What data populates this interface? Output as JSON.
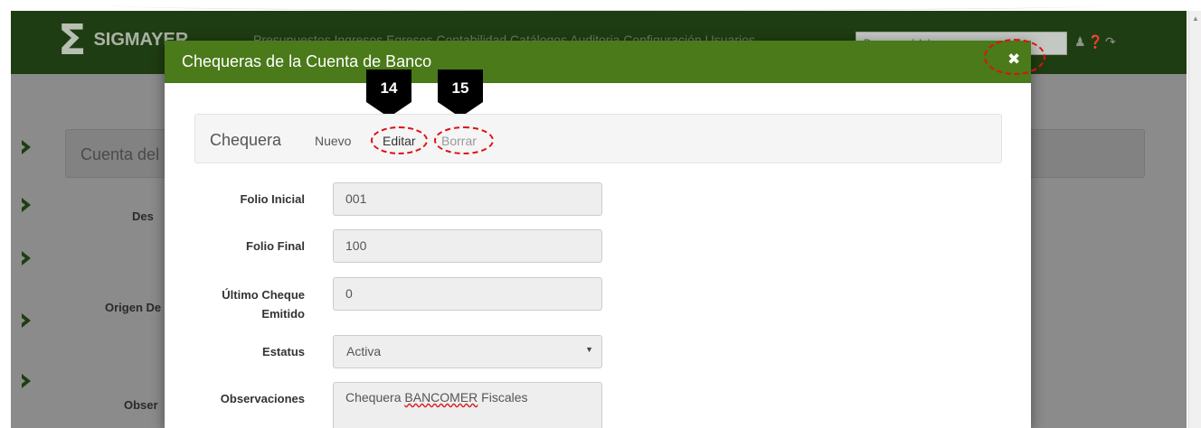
{
  "app": {
    "brand": "SIGMAYER",
    "nav_links": "Presupuestos  Ingresos  Egresos  Contabilidad  Catálogos  Auditoria  Configuración  Usuarios",
    "search_placeholder": "Buscar módulo o proceso...",
    "icons": [
      "user-icon",
      "help-icon",
      "logout-icon"
    ]
  },
  "background": {
    "panel_title": "Cuenta del",
    "labels": [
      "Des",
      "Origen De",
      "Obser"
    ]
  },
  "modal": {
    "title": "Chequeras de la Cuenta de Banco",
    "close_icon": "close-icon",
    "callouts": [
      "14",
      "15"
    ],
    "toolbar": {
      "title": "Chequera",
      "nuevo": "Nuevo",
      "editar": "Editar",
      "borrar": "Borrar"
    },
    "form": {
      "folio_inicial": {
        "label": "Folio Inicial",
        "value": "001"
      },
      "folio_final": {
        "label": "Folio Final",
        "value": "100"
      },
      "ultimo_cheque": {
        "label_1": "Último Cheque",
        "label_2": "Emitido",
        "value": "0"
      },
      "estatus": {
        "label": "Estatus",
        "value": "Activa"
      },
      "observaciones": {
        "label": "Observaciones",
        "value_a": "Chequera ",
        "value_b": "BANCOMER",
        "value_c": " Fiscales"
      }
    }
  },
  "colors": {
    "header_green": "#4a7a1a",
    "navbar_dark": "#1f3d12",
    "highlight_red": "#e01010"
  }
}
